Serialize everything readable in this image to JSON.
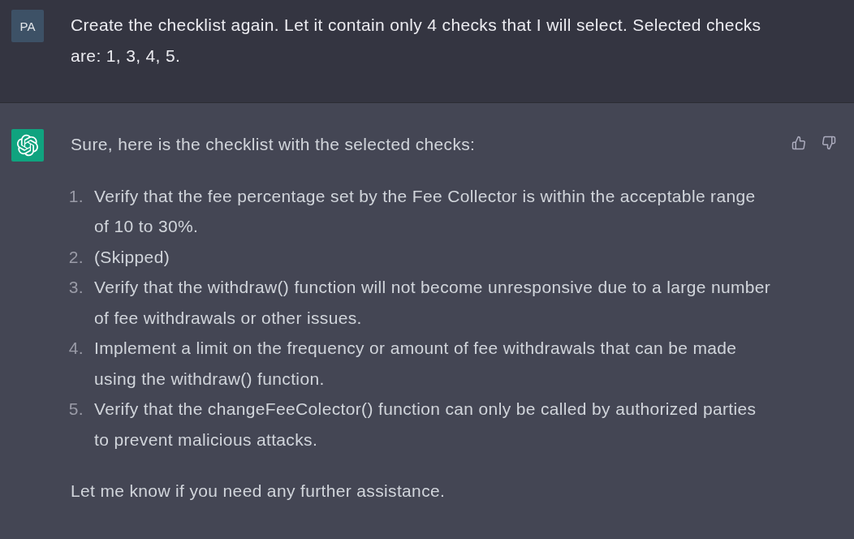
{
  "messages": [
    {
      "kind": "user",
      "avatar": "PA",
      "text": "Create the checklist again. Let it contain only 4 checks that I will select. Selected checks are: 1, 3, 4, 5."
    },
    {
      "kind": "assistant",
      "intro": "Sure, here is the checklist with the selected checks:",
      "items": [
        {
          "number": "1.",
          "text": "Verify that the fee percentage set by the Fee Collector is within the acceptable range of 10 to 30%."
        },
        {
          "number": "2.",
          "text": "(Skipped)"
        },
        {
          "number": "3.",
          "text": "Verify that the withdraw() function will not become unresponsive due to a large number of fee withdrawals or other issues."
        },
        {
          "number": "4.",
          "text": "Implement a limit on the frequency or amount of fee withdrawals that can be made using the withdraw() function."
        },
        {
          "number": "5.",
          "text": "Verify that the changeFeeColector() function can only be called by authorized parties to prevent malicious attacks."
        }
      ],
      "outro": "Let me know if you need any further assistance."
    }
  ]
}
